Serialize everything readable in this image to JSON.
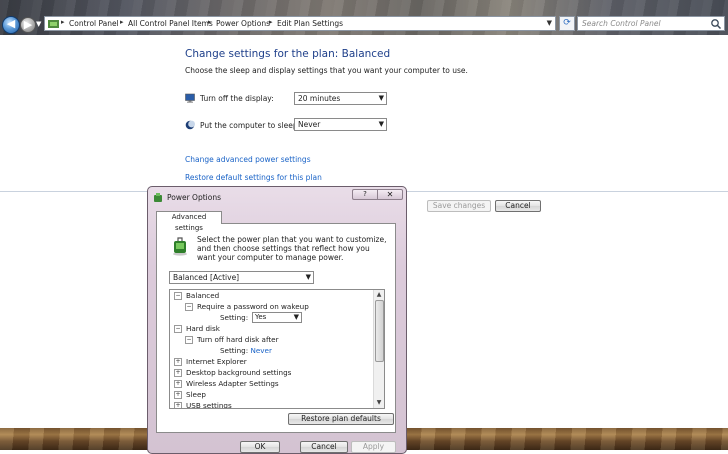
{
  "address": {
    "crumbs": [
      "Control Panel",
      "All Control Panel Items",
      "Power Options",
      "Edit Plan Settings"
    ],
    "separator": "▸"
  },
  "search": {
    "placeholder": "Search Control Panel"
  },
  "main": {
    "title": "Change settings for the plan: Balanced",
    "subtitle": "Choose the sleep and display settings that you want your computer to use.",
    "display_label": "Turn off the display:",
    "display_value": "20 minutes",
    "sleep_label": "Put the computer to sleep:",
    "sleep_value": "Never",
    "advanced_link": "Change advanced power settings",
    "restore_link": "Restore default settings for this plan",
    "save_button": "Save changes",
    "cancel_button": "Cancel"
  },
  "dialog": {
    "title": "Power Options",
    "help_glyph": "?",
    "close_glyph": "✕",
    "tab": "Advanced settings",
    "description": "Select the power plan that you want to customize, and then choose settings that reflect how you want your computer to manage power.",
    "plan_value": "Balanced [Active]",
    "tree": {
      "balanced": "Balanced",
      "require_password": "Require a password on wakeup",
      "setting_label": "Setting:",
      "password_value": "Yes",
      "hard_disk": "Hard disk",
      "turn_off_hd": "Turn off hard disk after",
      "hd_setting_label": "Setting:",
      "hd_value": "Never",
      "internet_explorer": "Internet Explorer",
      "desktop_bg": "Desktop background settings",
      "wireless": "Wireless Adapter Settings",
      "sleep": "Sleep",
      "usb": "USB settings"
    },
    "restore_button": "Restore plan defaults",
    "ok_button": "OK",
    "cancel_button": "Cancel",
    "apply_button": "Apply"
  }
}
